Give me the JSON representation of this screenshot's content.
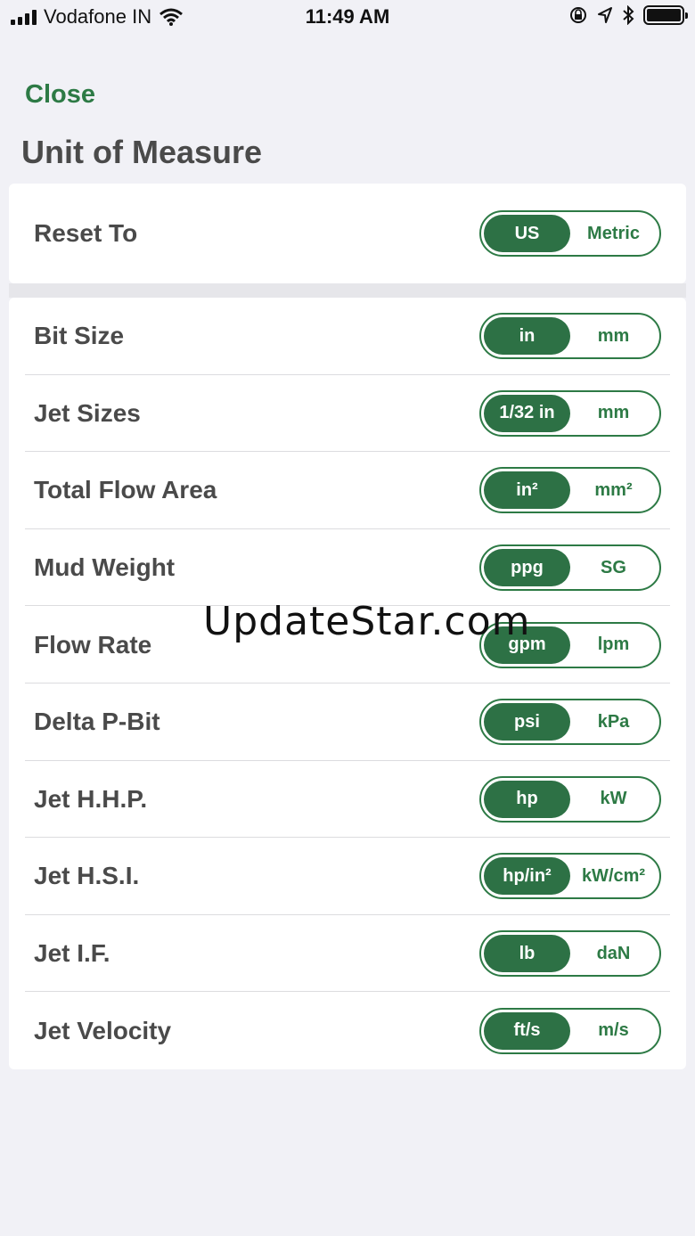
{
  "status_bar": {
    "carrier": "Vodafone IN",
    "time": "11:49 AM",
    "icons": [
      "signal-icon",
      "wifi-icon",
      "rotation-lock-icon",
      "location-icon",
      "bluetooth-icon",
      "battery-icon"
    ]
  },
  "header": {
    "close_label": "Close",
    "title": "Unit of Measure"
  },
  "reset": {
    "label": "Reset To",
    "options": [
      "US",
      "Metric"
    ],
    "selected": "US"
  },
  "units": [
    {
      "label": "Bit Size",
      "options": [
        "in",
        "mm"
      ],
      "selected": "in"
    },
    {
      "label": "Jet Sizes",
      "options": [
        "1/32 in",
        "mm"
      ],
      "selected": "1/32 in"
    },
    {
      "label": "Total Flow Area",
      "options": [
        "in²",
        "mm²"
      ],
      "selected": "in²"
    },
    {
      "label": "Mud Weight",
      "options": [
        "ppg",
        "SG"
      ],
      "selected": "ppg"
    },
    {
      "label": "Flow Rate",
      "options": [
        "gpm",
        "lpm"
      ],
      "selected": "gpm"
    },
    {
      "label": "Delta P-Bit",
      "options": [
        "psi",
        "kPa"
      ],
      "selected": "psi"
    },
    {
      "label": "Jet H.H.P.",
      "options": [
        "hp",
        "kW"
      ],
      "selected": "hp"
    },
    {
      "label": "Jet H.S.I.",
      "options": [
        "hp/in²",
        "kW/cm²"
      ],
      "selected": "hp/in²"
    },
    {
      "label": "Jet I.F.",
      "options": [
        "lb",
        "daN"
      ],
      "selected": "lb"
    },
    {
      "label": "Jet Velocity",
      "options": [
        "ft/s",
        "m/s"
      ],
      "selected": "ft/s"
    }
  ],
  "watermark": "UpdateStar.com",
  "colors": {
    "accent": "#2d7a45",
    "background": "#f1f1f6"
  }
}
